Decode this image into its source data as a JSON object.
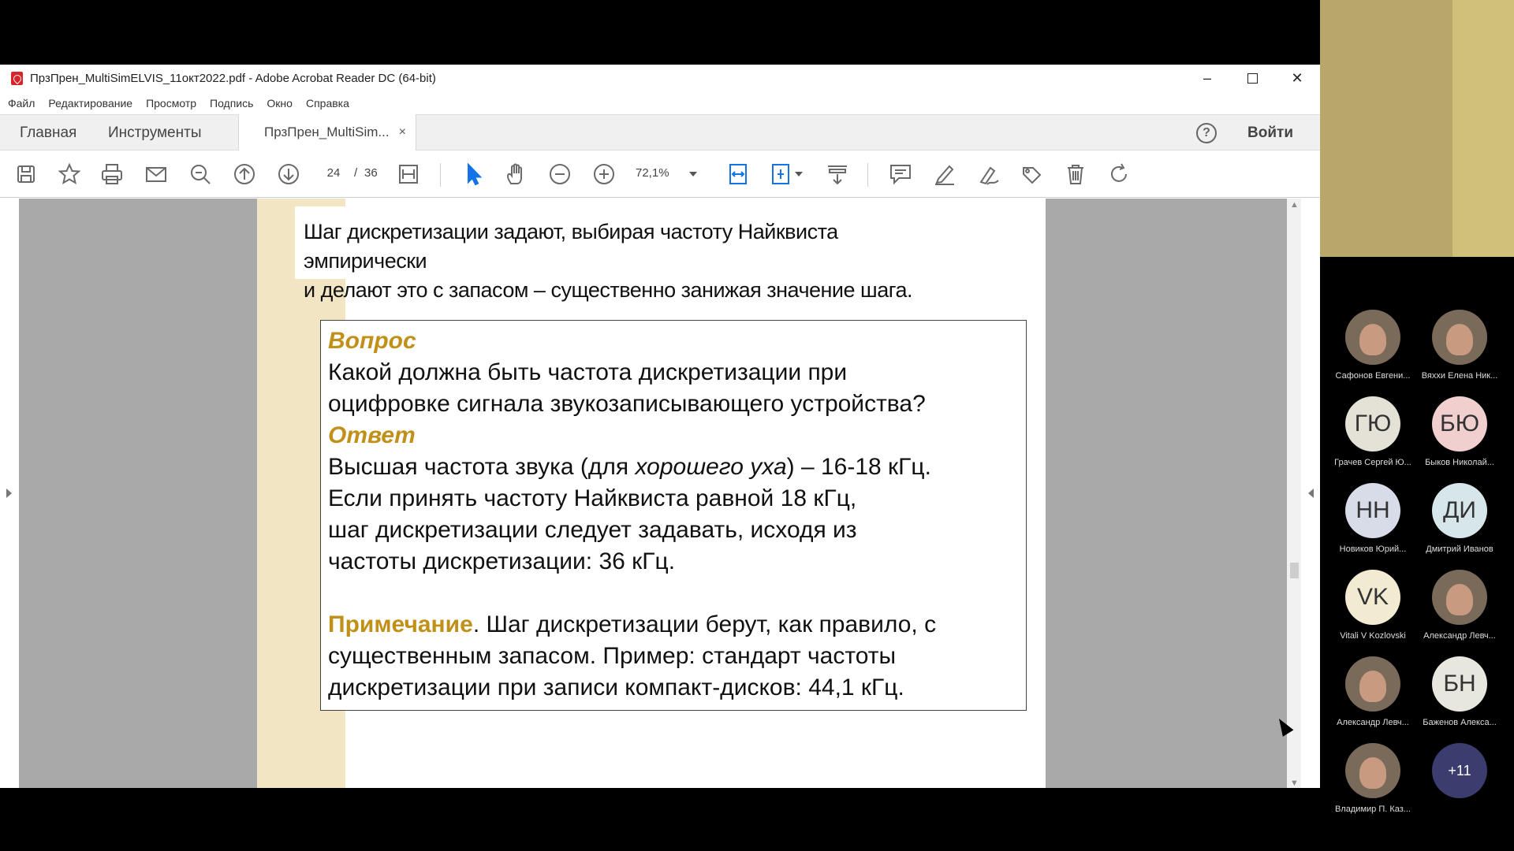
{
  "window": {
    "title": "ПрзПрен_MultiSimELVIS_11окт2022.pdf - Adobe Acrobat Reader DC (64-bit)",
    "minimize_glyph": "–",
    "close_glyph": "✕"
  },
  "menu": [
    "Файл",
    "Редактирование",
    "Просмотр",
    "Подпись",
    "Окно",
    "Справка"
  ],
  "tabs": {
    "home": "Главная",
    "tools": "Инструменты",
    "document": "ПрзПрен_MultiSim...",
    "close_glyph": "×",
    "help_glyph": "?",
    "login": "Войти"
  },
  "toolbar": {
    "page_current": "24",
    "page_separator": "/",
    "page_total": "36",
    "zoom": "72,1%",
    "icons": [
      "save-icon",
      "bookmark-star-icon",
      "print-icon",
      "email-icon",
      "search-icon",
      "page-up-icon",
      "page-down-icon",
      "fit-page-icon",
      "select-cursor-icon",
      "hand-icon",
      "zoom-out-icon",
      "zoom-in-icon",
      "fit-width-icon",
      "scroll-mode-icon",
      "read-mode-icon",
      "comment-icon",
      "highlight-icon",
      "sign-icon",
      "stamp-icon",
      "delete-icon",
      "rotate-icon"
    ]
  },
  "document": {
    "top_text": [
      "Шаг дискретизации задают, выбирая частоту Найквиста эмпирически",
      "и делают это с запасом – существенно занижая значение шага."
    ],
    "question_label": "Вопрос",
    "question_lines": [
      "Какой должна быть частота дискретизации при",
      "оцифровке сигнала звукозаписывающего устройства?"
    ],
    "answer_label": "Ответ",
    "answer_line1_a": "Высшая частота звука (для ",
    "answer_line1_italic": "хорошего уха",
    "answer_line1_b": ") – 16-18 кГц.",
    "answer_lines": [
      "Если принять частоту Найквиста равной 18 кГц,",
      "шаг дискретизации следует задавать, исходя из",
      "частоты дискретизации: 36 кГц."
    ],
    "note_label": "Примечание",
    "note_line1": ". Шаг дискретизации берут, как правило, с",
    "note_lines": [
      "существенным запасом. Пример: стандарт частоты",
      "дискретизации при записи компакт-дисков: 44,1 кГц."
    ]
  },
  "participants": [
    {
      "initials": "",
      "name": "Сафонов Евгени...",
      "photo": true
    },
    {
      "initials": "",
      "name": "Вяххи Елена Ник...",
      "photo": true
    },
    {
      "initials": "ГЮ",
      "name": "Грачев Сергей Ю...",
      "photo": false
    },
    {
      "initials": "БЮ",
      "name": "Быков Николай...",
      "photo": false
    },
    {
      "initials": "НН",
      "name": "Новиков Юрий...",
      "photo": false
    },
    {
      "initials": "ДИ",
      "name": "Дмитрий Иванов",
      "photo": false
    },
    {
      "initials": "VK",
      "name": "Vitali V Kozlovski",
      "photo": false
    },
    {
      "initials": "",
      "name": "Александр Левч...",
      "photo": true
    },
    {
      "initials": "",
      "name": "Александр Левч...",
      "photo": true
    },
    {
      "initials": "БН",
      "name": "Баженов Алекса...",
      "photo": false
    },
    {
      "initials": "",
      "name": "Владимир П. Каз...",
      "photo": true
    },
    {
      "initials": "+11",
      "name": "",
      "photo": false
    }
  ],
  "colors": {
    "accent_gold": "#c09018",
    "page_stripe": "#f1e5c3",
    "acrobat_red": "#d8232a",
    "active_tool": "#1473e6"
  }
}
